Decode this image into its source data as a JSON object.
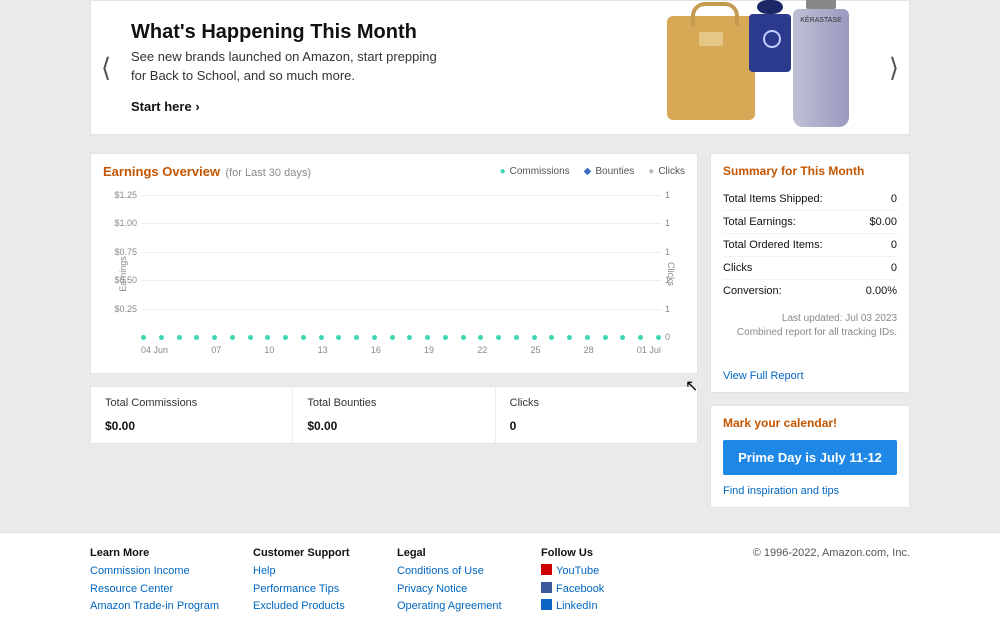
{
  "banner": {
    "title": "What's Happening This Month",
    "subtitle": "See new brands launched on Amazon, start prepping for Back to School, and so much more.",
    "cta": "Start here",
    "tube_brand": "KÉRASTASE"
  },
  "earnings": {
    "title": "Earnings Overview",
    "period": "(for Last 30 days)",
    "legend": {
      "commissions": "Commissions",
      "bounties": "Bounties",
      "clicks": "Clicks"
    },
    "axis_left_title": "Earnings",
    "axis_right_title": "Clicks"
  },
  "chart_data": {
    "type": "line",
    "x_ticks": [
      "04 Jun",
      "07",
      "10",
      "13",
      "16",
      "19",
      "22",
      "25",
      "28",
      "01 Jul"
    ],
    "categories": [
      "04 Jun",
      "05",
      "06",
      "07",
      "08",
      "09",
      "10",
      "11",
      "12",
      "13",
      "14",
      "15",
      "16",
      "17",
      "18",
      "19",
      "20",
      "21",
      "22",
      "23",
      "24",
      "25",
      "26",
      "27",
      "28",
      "29",
      "30",
      "01 Jul",
      "02",
      "03"
    ],
    "series": [
      {
        "name": "Commissions",
        "values": [
          0,
          0,
          0,
          0,
          0,
          0,
          0,
          0,
          0,
          0,
          0,
          0,
          0,
          0,
          0,
          0,
          0,
          0,
          0,
          0,
          0,
          0,
          0,
          0,
          0,
          0,
          0,
          0,
          0,
          0
        ]
      },
      {
        "name": "Bounties",
        "values": [
          0,
          0,
          0,
          0,
          0,
          0,
          0,
          0,
          0,
          0,
          0,
          0,
          0,
          0,
          0,
          0,
          0,
          0,
          0,
          0,
          0,
          0,
          0,
          0,
          0,
          0,
          0,
          0,
          0,
          0
        ]
      },
      {
        "name": "Clicks",
        "values": [
          0,
          0,
          0,
          0,
          0,
          0,
          0,
          0,
          0,
          0,
          0,
          0,
          0,
          0,
          0,
          0,
          0,
          0,
          0,
          0,
          0,
          0,
          0,
          0,
          0,
          0,
          0,
          0,
          0,
          0
        ]
      }
    ],
    "y_left": {
      "label": "Earnings",
      "ticks": [
        "$0.25",
        "$0.50",
        "$0.75",
        "$1.00",
        "$1.25"
      ],
      "range": [
        0,
        1.25
      ]
    },
    "y_right": {
      "label": "Clicks",
      "ticks": [
        "0",
        "1",
        "1",
        "1",
        "1",
        "1"
      ],
      "range": [
        0,
        1
      ]
    }
  },
  "stats": {
    "commissions_label": "Total Commissions",
    "commissions_value": "$0.00",
    "bounties_label": "Total Bounties",
    "bounties_value": "$0.00",
    "clicks_label": "Clicks",
    "clicks_value": "0"
  },
  "summary": {
    "title": "Summary for This Month",
    "rows": [
      {
        "label": "Total Items Shipped:",
        "value": "0"
      },
      {
        "label": "Total Earnings:",
        "value": "$0.00"
      },
      {
        "label": "Total Ordered Items:",
        "value": "0"
      },
      {
        "label": "Clicks",
        "value": "0"
      },
      {
        "label": "Conversion:",
        "value": "0.00%"
      }
    ],
    "meta1": "Last updated: Jul 03 2023",
    "meta2": "Combined report for all tracking IDs.",
    "view_link": "View Full Report"
  },
  "calendar": {
    "title": "Mark your calendar!",
    "button": "Prime Day is July 11-12",
    "link": "Find inspiration and tips"
  },
  "footer": {
    "cols": [
      {
        "head": "Learn More",
        "links": [
          "Commission Income",
          "Resource Center",
          "Amazon Trade-in Program"
        ]
      },
      {
        "head": "Customer Support",
        "links": [
          "Help",
          "Performance Tips",
          "Excluded Products"
        ]
      },
      {
        "head": "Legal",
        "links": [
          "Conditions of Use",
          "Privacy Notice",
          "Operating Agreement"
        ]
      },
      {
        "head": "Follow Us",
        "links": [
          "YouTube",
          "Facebook",
          "LinkedIn"
        ]
      }
    ],
    "copyright": "© 1996-2022, Amazon.com, Inc."
  }
}
